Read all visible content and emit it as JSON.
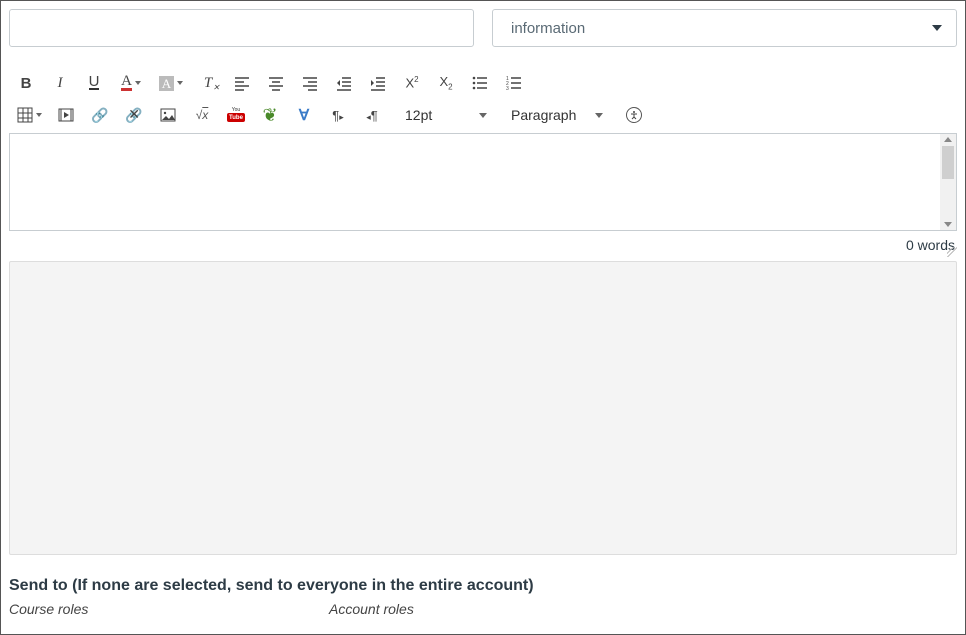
{
  "header": {
    "subject_value": "",
    "subject_placeholder": "",
    "type_selected": "information"
  },
  "toolbar": {
    "bold_label": "B",
    "italic_label": "I",
    "underline_label": "U",
    "textcolor_label": "A",
    "bgcolor_label": "A",
    "clearformat_label": "T",
    "alignleft": "≡",
    "aligncenter": "≡",
    "alignright": "≡",
    "outdent": "⇤",
    "indent": "⇥",
    "superscript": "X²",
    "subscript": "X₂",
    "bullist": "•≡",
    "numlist": "1≡",
    "table": "▦",
    "media": "▶",
    "link": "🔗",
    "unlink": "✕",
    "image": "🖼",
    "equation": "√x",
    "youtube": "Tube",
    "youtube_top": "You",
    "eco": "❧",
    "vcheck": "∀",
    "ltr": "¶‣",
    "rtl": "‣¶",
    "font_size": "12pt",
    "block_format": "Paragraph",
    "a11y": "✲"
  },
  "editor": {
    "content": "",
    "word_count": "0 words"
  },
  "send_to": {
    "heading": "Send to (If none are selected, send to everyone in the entire account)",
    "course_roles_label": "Course roles",
    "account_roles_label": "Account roles"
  }
}
